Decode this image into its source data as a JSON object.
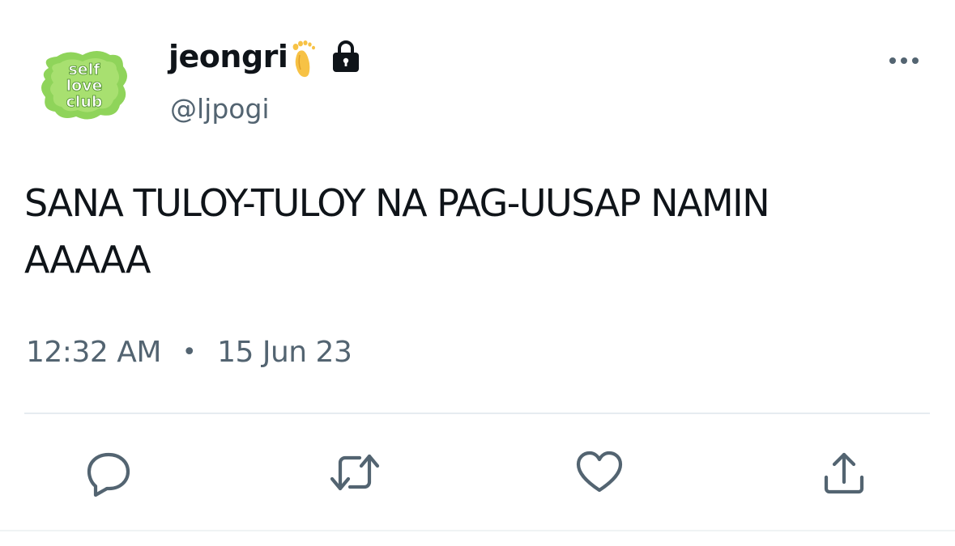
{
  "tweet": {
    "display_name": "jeongri",
    "handle": "@ljpogi",
    "avatar_text": "self love club",
    "text": "SANA TULOY-TULOY NA PAG-UUSAP NAMIN\nAAAAA",
    "time": "12:32 AM",
    "separator": "•",
    "date": "15 Jun 23"
  },
  "icons": {
    "display_name_emoji": "foot-icon",
    "protected": "lock-icon",
    "more": "more-horizontal-icon",
    "reply": "reply-icon",
    "retweet": "retweet-icon",
    "like": "heart-icon",
    "share": "share-icon"
  },
  "colors": {
    "text_primary": "#0f1419",
    "text_secondary": "#536471",
    "avatar_green": "#8fd45a",
    "divider": "#e6ecf0"
  }
}
